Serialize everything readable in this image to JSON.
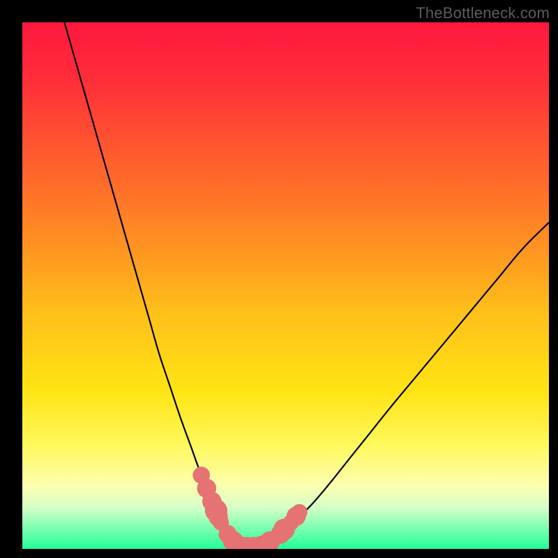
{
  "watermark": "TheBottleneck.com",
  "chart_data": {
    "type": "line",
    "title": "",
    "xlabel": "",
    "ylabel": "",
    "xlim": [
      0,
      100
    ],
    "ylim": [
      0,
      100
    ],
    "grid": false,
    "legend": false,
    "background_gradient_stops": [
      {
        "offset": 0.0,
        "color": "#ff183f"
      },
      {
        "offset": 0.1,
        "color": "#ff2b3a"
      },
      {
        "offset": 0.25,
        "color": "#ff5a2e"
      },
      {
        "offset": 0.4,
        "color": "#ff8a24"
      },
      {
        "offset": 0.55,
        "color": "#ffbf1a"
      },
      {
        "offset": 0.7,
        "color": "#ffe414"
      },
      {
        "offset": 0.8,
        "color": "#fff85a"
      },
      {
        "offset": 0.88,
        "color": "#fcffb0"
      },
      {
        "offset": 0.92,
        "color": "#d8ffc8"
      },
      {
        "offset": 0.96,
        "color": "#7dffb1"
      },
      {
        "offset": 1.0,
        "color": "#24ff9a"
      }
    ],
    "series": [
      {
        "name": "bottleneck-curve",
        "color": "#000000",
        "x": [
          8,
          10,
          12,
          14,
          16,
          18,
          20,
          22,
          24,
          26,
          28,
          30,
          32,
          34,
          36,
          37,
          38.5,
          40,
          41,
          44,
          46,
          48,
          50,
          52,
          55,
          58,
          62,
          66,
          70,
          75,
          80,
          85,
          90,
          95,
          100
        ],
        "y": [
          100,
          93,
          86,
          79,
          72,
          65,
          58,
          51,
          44,
          37,
          31,
          25,
          19.5,
          14,
          9.5,
          6.5,
          3.5,
          1.1,
          0.4,
          0.4,
          1.0,
          2.0,
          3.5,
          5.5,
          8.5,
          12,
          17,
          22,
          27,
          33,
          39,
          45,
          51,
          57,
          62
        ]
      }
    ],
    "markers": {
      "name": "trough-markers",
      "color": "#e57373",
      "points": [
        {
          "x": 34.0,
          "y": 14.0,
          "r": 1.1
        },
        {
          "x": 35.0,
          "y": 11.5,
          "r": 1.3
        },
        {
          "x": 36.0,
          "y": 9.0,
          "r": 1.3
        },
        {
          "x": 36.8,
          "y": 7.3,
          "r": 1.6
        },
        {
          "x": 37.2,
          "y": 6.1,
          "r": 1.3
        },
        {
          "x": 37.7,
          "y": 5.0,
          "r": 1.0
        },
        {
          "x": 39.0,
          "y": 2.8,
          "r": 1.2
        },
        {
          "x": 40.0,
          "y": 1.5,
          "r": 1.4
        },
        {
          "x": 41.0,
          "y": 0.6,
          "r": 1.4
        },
        {
          "x": 42.5,
          "y": 0.35,
          "r": 1.4
        },
        {
          "x": 44.0,
          "y": 0.35,
          "r": 1.4
        },
        {
          "x": 45.5,
          "y": 0.6,
          "r": 1.4
        },
        {
          "x": 47.0,
          "y": 1.4,
          "r": 1.4
        },
        {
          "x": 49.0,
          "y": 2.8,
          "r": 1.3
        },
        {
          "x": 49.7,
          "y": 3.7,
          "r": 1.5
        },
        {
          "x": 50.1,
          "y": 4.3,
          "r": 0.9
        },
        {
          "x": 51.0,
          "y": 5.0,
          "r": 1.0
        },
        {
          "x": 52.0,
          "y": 6.2,
          "r": 1.3
        },
        {
          "x": 52.6,
          "y": 7.0,
          "r": 1.0
        }
      ]
    }
  }
}
